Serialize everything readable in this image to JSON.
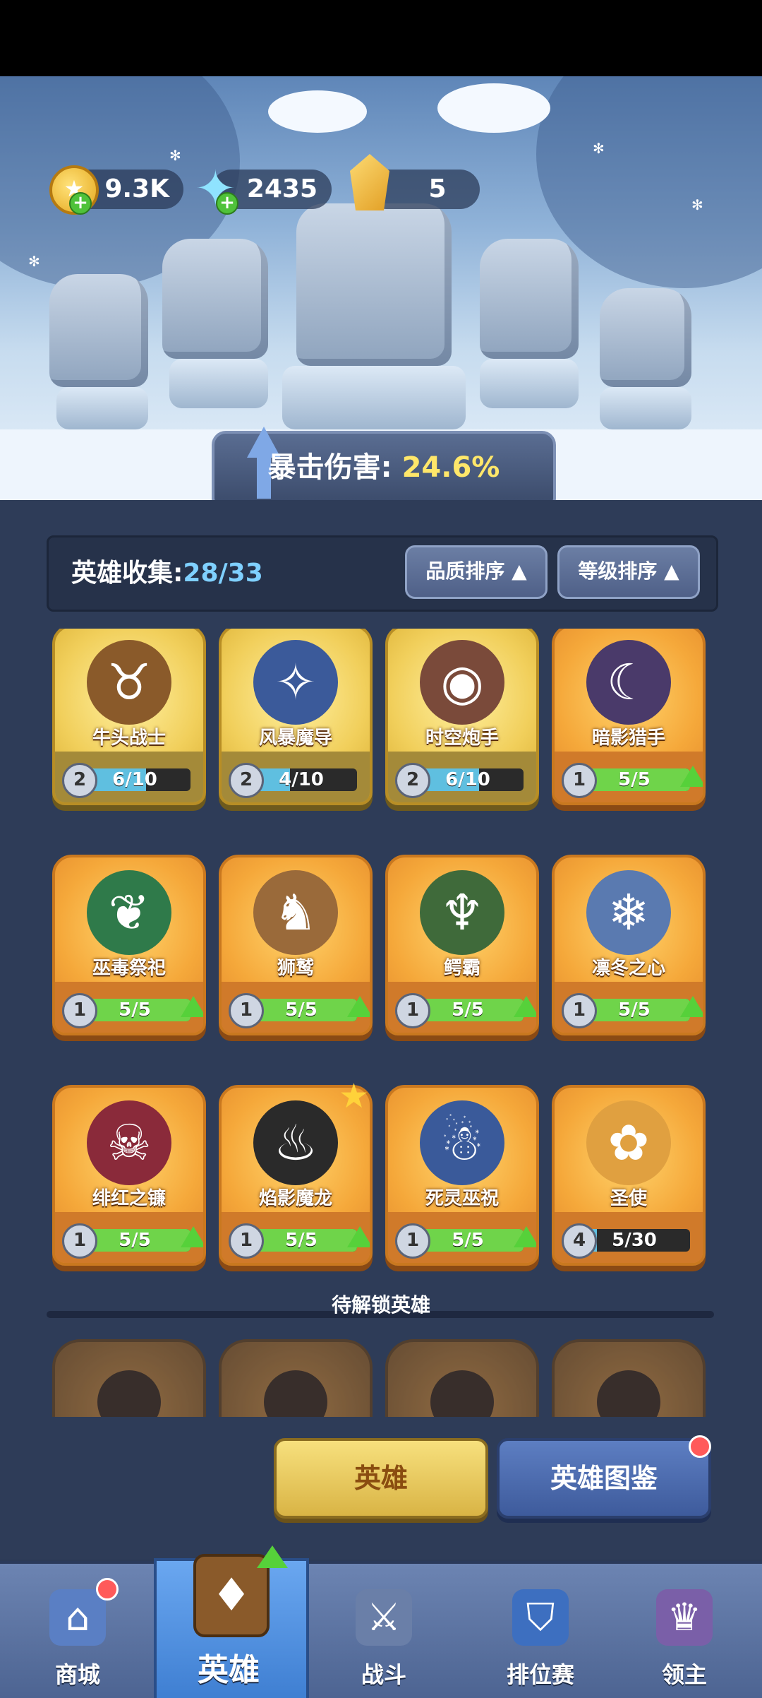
{
  "currencies": {
    "coins": "9.3K",
    "crystals": "2435",
    "gems": "5"
  },
  "banner": {
    "label": "暴击伤害:",
    "value": "24.6%"
  },
  "collection": {
    "label": "英雄收集:",
    "value": "28/33",
    "sort_quality": "品质排序",
    "sort_level": "等级排序"
  },
  "heroes": [
    {
      "name": "牛头战士",
      "level": "2",
      "progress": "6/10",
      "fill": 0.6,
      "upgrade": false,
      "style": "gold"
    },
    {
      "name": "风暴魔导",
      "level": "2",
      "progress": "4/10",
      "fill": 0.4,
      "upgrade": false,
      "style": "gold"
    },
    {
      "name": "时空炮手",
      "level": "2",
      "progress": "6/10",
      "fill": 0.6,
      "upgrade": false,
      "style": "gold"
    },
    {
      "name": "暗影猎手",
      "level": "1",
      "progress": "5/5",
      "fill": 1,
      "upgrade": true,
      "style": "orange"
    },
    {
      "name": "巫毒祭祀",
      "level": "1",
      "progress": "5/5",
      "fill": 1,
      "upgrade": true,
      "style": "orange"
    },
    {
      "name": "狮鹫",
      "level": "1",
      "progress": "5/5",
      "fill": 1,
      "upgrade": true,
      "style": "orange"
    },
    {
      "name": "鳄霸",
      "level": "1",
      "progress": "5/5",
      "fill": 1,
      "upgrade": true,
      "style": "orange"
    },
    {
      "name": "凛冬之心",
      "level": "1",
      "progress": "5/5",
      "fill": 1,
      "upgrade": true,
      "style": "orange"
    },
    {
      "name": "绯红之镰",
      "level": "1",
      "progress": "5/5",
      "fill": 1,
      "upgrade": true,
      "style": "orange"
    },
    {
      "name": "焰影魔龙",
      "level": "1",
      "progress": "5/5",
      "fill": 1,
      "upgrade": true,
      "style": "orange",
      "starred": true
    },
    {
      "name": "死灵巫祝",
      "level": "1",
      "progress": "5/5",
      "fill": 1,
      "upgrade": true,
      "style": "orange"
    },
    {
      "name": "圣使",
      "level": "4",
      "progress": "5/30",
      "fill": 0.1667,
      "upgrade": false,
      "style": "orange"
    }
  ],
  "pending_title": "待解锁英雄",
  "buttons": {
    "hero": "英雄",
    "codex": "英雄图鉴"
  },
  "nav": [
    {
      "label": "商城",
      "icon": "shop-icon",
      "badge": true
    },
    {
      "label": "英雄",
      "icon": "hero-card-icon",
      "active": true
    },
    {
      "label": "战斗",
      "icon": "battle-icon"
    },
    {
      "label": "排位赛",
      "icon": "ranking-icon"
    },
    {
      "label": "领主",
      "icon": "lord-icon"
    }
  ],
  "colors": {
    "accent_yellow": "#ffe76a",
    "accent_blue": "#7fd0ff",
    "upgrade_green": "#56d13a"
  }
}
